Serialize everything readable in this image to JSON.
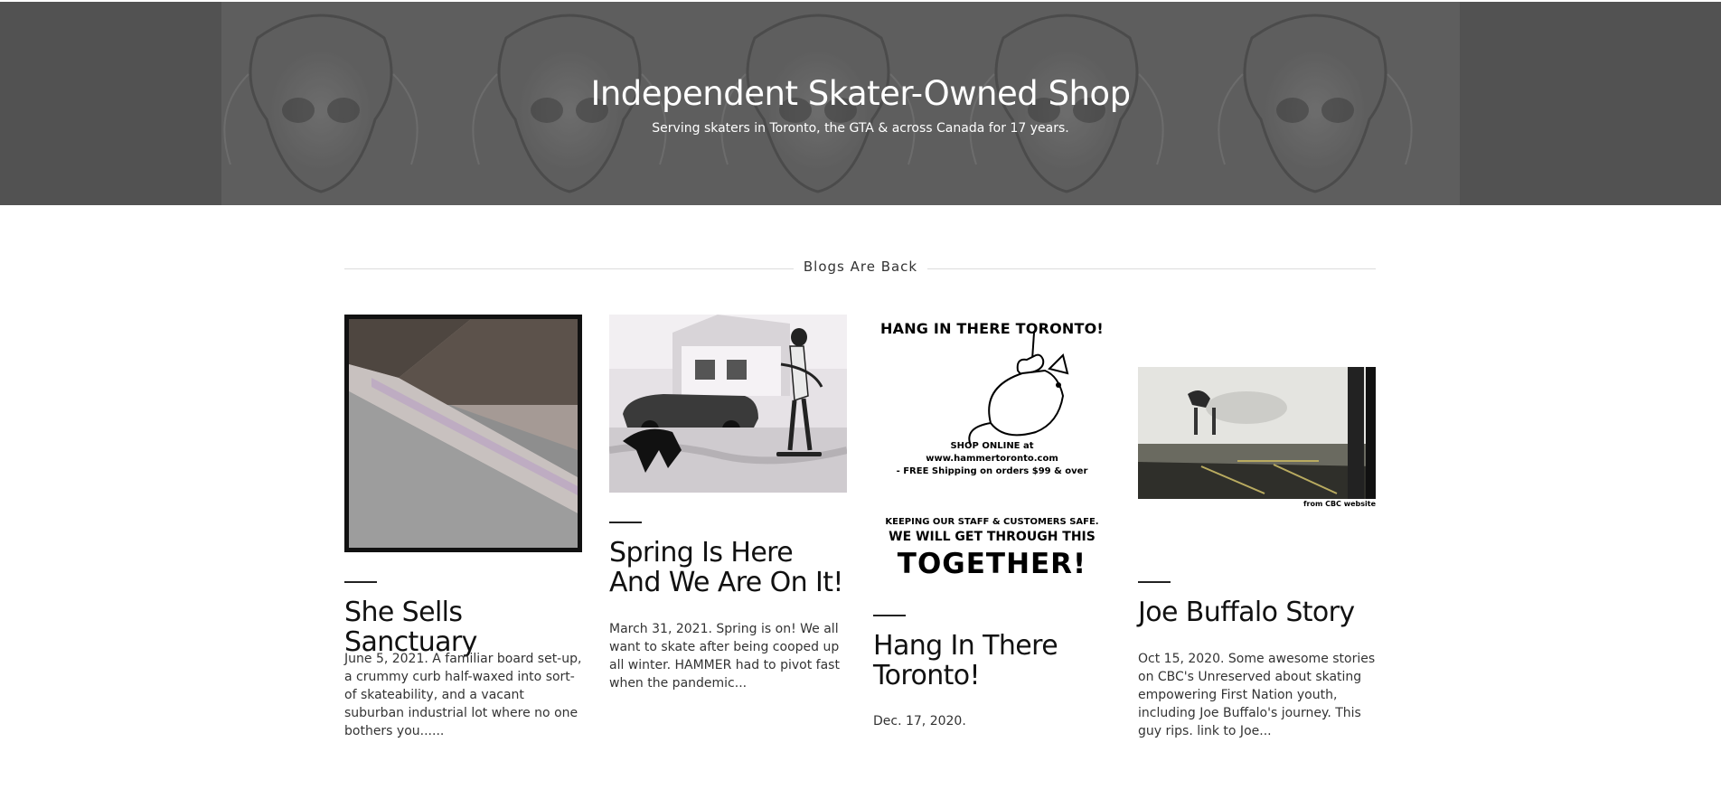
{
  "hero": {
    "title": "Independent Skater-Owned Shop",
    "subtitle": "Serving skaters in Toronto, the GTA & across Canada for 17 years."
  },
  "section": {
    "title": "Blogs Are Back"
  },
  "posts": [
    {
      "title": "She Sells Sanctuary",
      "excerpt": "June 5, 2021. A familiar board set-up, a crummy curb half-waxed into sort-of skateability, and a vacant suburban industrial lot where no one bothers you......"
    },
    {
      "title": "Spring Is Here And We Are On It!",
      "excerpt": "March 31, 2021. Spring is on!  We all want to skate after being cooped up all winter.  HAMMER had to pivot fast when the pandemic..."
    },
    {
      "title": "Hang In There Toronto!",
      "excerpt": "Dec. 17, 2020.",
      "poster": {
        "headline": "HANG IN THERE TORONTO!",
        "shop_line1": "SHOP ONLINE at",
        "shop_line2": "www.hammertoronto.com",
        "shop_line3": "- FREE Shipping on orders $99 & over",
        "safety": "KEEPING OUR STAFF & CUSTOMERS SAFE.",
        "through": "WE WILL GET THROUGH THIS",
        "together": "TOGETHER!"
      }
    },
    {
      "title": "Joe Buffalo Story",
      "excerpt": "Oct 15, 2020.  Some awesome stories on CBC's Unreserved about skating empowering First Nation youth, including Joe Buffalo's journey. This guy rips. link to Joe...",
      "caption": "from CBC website"
    }
  ],
  "icons": {
    "hero_pattern": "skull-tattoo-pattern"
  },
  "colors": {
    "hero_bg": "#5a5a5a",
    "text": "#111111",
    "divider": "#222222"
  }
}
